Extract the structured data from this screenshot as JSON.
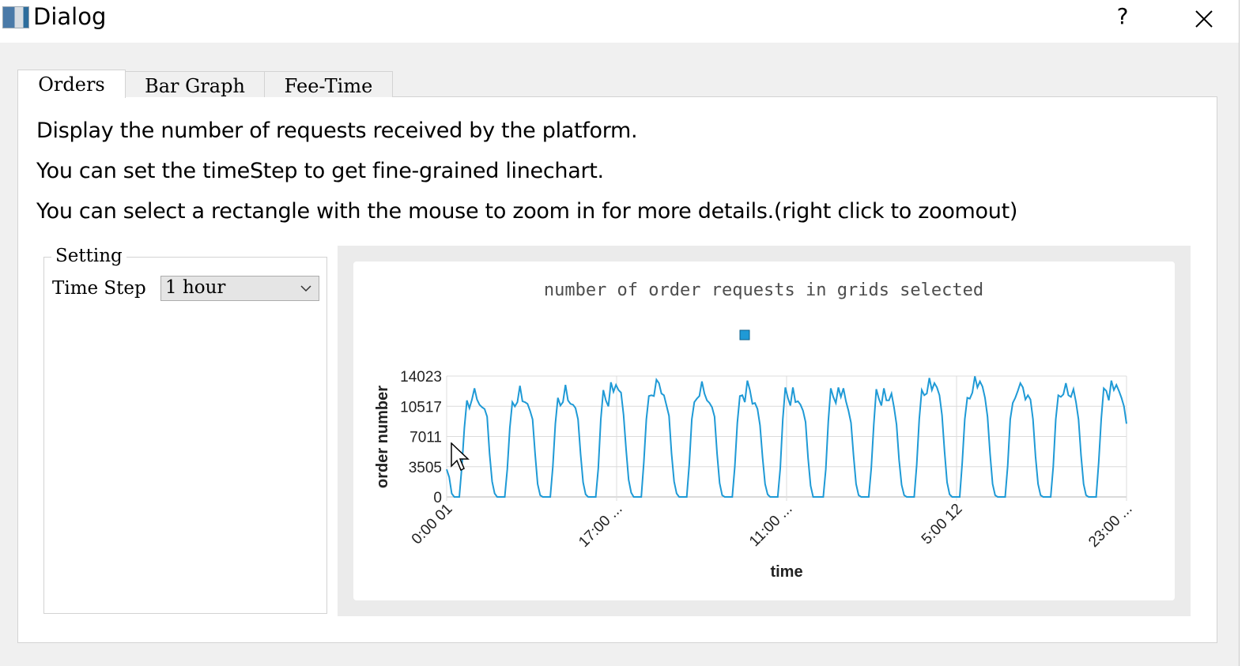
{
  "window": {
    "title": "Dialog",
    "help_label": "?"
  },
  "tabs": [
    {
      "label": "Orders",
      "active": true
    },
    {
      "label": "Bar Graph",
      "active": false
    },
    {
      "label": "Fee-Time",
      "active": false
    }
  ],
  "description": [
    "Display the number of requests received by the platform.",
    "You can set the timeStep to get fine-grained linechart.",
    "You can select a rectangle with the mouse to zoom in for more details.(right click to zoomout)"
  ],
  "settings": {
    "group_title": "Setting",
    "time_step_label": "Time Step",
    "time_step_value": "1 hour"
  },
  "colors": {
    "series": "#1f9ad6",
    "grid": "#dcdcdc"
  },
  "chart_data": {
    "type": "line",
    "title": "number of order requests in grids selected",
    "xlabel": "time",
    "ylabel": "order number",
    "yticks": [
      "0",
      "3505",
      "7011",
      "10517",
      "14023"
    ],
    "ylim": [
      0,
      14023
    ],
    "xticks": [
      "0:00 01",
      "17:00 ...",
      "11:00 ...",
      "5:00 12",
      "23:00 ..."
    ],
    "legend": {
      "position": "top-center",
      "entries": [
        ""
      ]
    },
    "grid": true,
    "series": [
      {
        "values": [
          3200,
          2300,
          400,
          0,
          0,
          0,
          3500,
          8000,
          11200,
          10300,
          11300,
          12600,
          11300,
          10700,
          10400,
          10200,
          9300,
          5000,
          1800,
          400,
          0,
          0,
          0,
          0,
          3200,
          8000,
          11000,
          10500,
          11000,
          12900,
          11100,
          11000,
          10800,
          10000,
          9000,
          5000,
          1500,
          200,
          0,
          0,
          0,
          0,
          3500,
          8500,
          11500,
          10600,
          11000,
          13000,
          11200,
          10800,
          10700,
          10300,
          9000,
          5000,
          1700,
          300,
          0,
          0,
          0,
          0,
          3300,
          9000,
          12400,
          11200,
          10500,
          13300,
          12200,
          13000,
          12400,
          12100,
          9500,
          5500,
          2000,
          500,
          0,
          0,
          0,
          0,
          4000,
          9000,
          11700,
          11800,
          11700,
          13600,
          13200,
          12000,
          11800,
          10600,
          9400,
          5000,
          1800,
          400,
          0,
          0,
          0,
          0,
          3800,
          9000,
          11000,
          11400,
          11700,
          13400,
          12000,
          11200,
          10900,
          10400,
          9300,
          5000,
          1600,
          200,
          0,
          0,
          0,
          0,
          3500,
          8600,
          11700,
          11800,
          11000,
          13500,
          12400,
          10800,
          10900,
          10200,
          8300,
          4600,
          1500,
          300,
          0,
          0,
          0,
          0,
          3300,
          9000,
          12700,
          11500,
          10600,
          12700,
          11000,
          11100,
          10700,
          10000,
          8700,
          4500,
          1300,
          0,
          0,
          0,
          0,
          0,
          3200,
          8800,
          12600,
          11600,
          10900,
          12700,
          11600,
          12600,
          11100,
          10000,
          8600,
          4800,
          1500,
          200,
          0,
          0,
          0,
          0,
          3300,
          8400,
          12500,
          11400,
          10600,
          12600,
          11200,
          11200,
          12000,
          10400,
          8400,
          4300,
          1400,
          200,
          0,
          0,
          0,
          0,
          3700,
          9000,
          12400,
          11800,
          12000,
          13800,
          12400,
          13200,
          12700,
          11800,
          9500,
          5300,
          1700,
          300,
          0,
          0,
          0,
          0,
          4000,
          9000,
          11500,
          11400,
          12100,
          14000,
          12700,
          13400,
          12800,
          11500,
          9300,
          5000,
          1500,
          200,
          0,
          0,
          0,
          0,
          3600,
          9000,
          10900,
          11500,
          12300,
          13200,
          12700,
          11300,
          11800,
          11300,
          9000,
          4700,
          1500,
          200,
          0,
          0,
          0,
          0,
          3500,
          9000,
          11800,
          11600,
          11900,
          13200,
          11800,
          11600,
          12500,
          11000,
          9000,
          4800,
          1500,
          200,
          0,
          0,
          0,
          0,
          4000,
          9000,
          12600,
          12300,
          11200,
          13500,
          12400,
          13000,
          12300,
          11500,
          10500,
          8500
        ]
      }
    ]
  }
}
